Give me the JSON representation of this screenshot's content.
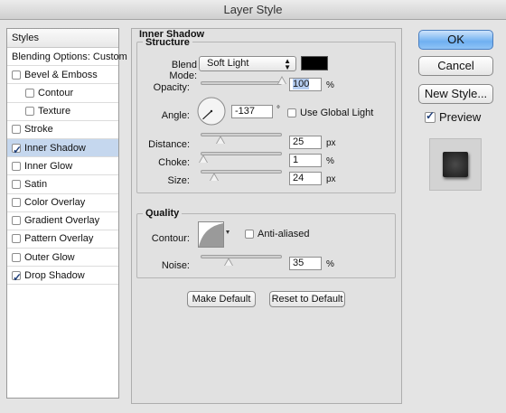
{
  "window": {
    "title": "Layer Style"
  },
  "styles_list": {
    "header": "Styles",
    "blending": "Blending Options: Custom",
    "items": [
      {
        "label": "Bevel & Emboss",
        "checked": false,
        "indent": false,
        "selected": false
      },
      {
        "label": "Contour",
        "checked": false,
        "indent": true,
        "selected": false
      },
      {
        "label": "Texture",
        "checked": false,
        "indent": true,
        "selected": false
      },
      {
        "label": "Stroke",
        "checked": false,
        "indent": false,
        "selected": false
      },
      {
        "label": "Inner Shadow",
        "checked": true,
        "indent": false,
        "selected": true
      },
      {
        "label": "Inner Glow",
        "checked": false,
        "indent": false,
        "selected": false
      },
      {
        "label": "Satin",
        "checked": false,
        "indent": false,
        "selected": false
      },
      {
        "label": "Color Overlay",
        "checked": false,
        "indent": false,
        "selected": false
      },
      {
        "label": "Gradient Overlay",
        "checked": false,
        "indent": false,
        "selected": false
      },
      {
        "label": "Pattern Overlay",
        "checked": false,
        "indent": false,
        "selected": false
      },
      {
        "label": "Outer Glow",
        "checked": false,
        "indent": false,
        "selected": false
      },
      {
        "label": "Drop Shadow",
        "checked": true,
        "indent": false,
        "selected": false
      }
    ]
  },
  "inner_shadow": {
    "title": "Inner Shadow",
    "structure": {
      "title": "Structure",
      "blend_mode_label": "Blend Mode:",
      "blend_mode_value": "Soft Light",
      "shadow_color": "#000000",
      "opacity_label": "Opacity:",
      "opacity_value": "100",
      "opacity_unit": "%",
      "angle_label": "Angle:",
      "angle_value": "-137",
      "angle_unit": "°",
      "use_global_light_label": "Use Global Light",
      "use_global_light_checked": false,
      "distance_label": "Distance:",
      "distance_value": "25",
      "distance_unit": "px",
      "choke_label": "Choke:",
      "choke_value": "1",
      "choke_unit": "%",
      "size_label": "Size:",
      "size_value": "24",
      "size_unit": "px"
    },
    "quality": {
      "title": "Quality",
      "contour_label": "Contour:",
      "anti_aliased_label": "Anti-aliased",
      "anti_aliased_checked": false,
      "noise_label": "Noise:",
      "noise_value": "35",
      "noise_unit": "%"
    },
    "make_default_label": "Make Default",
    "reset_default_label": "Reset to Default"
  },
  "side_buttons": {
    "ok": "OK",
    "cancel": "Cancel",
    "new_style": "New Style...",
    "preview_label": "Preview",
    "preview_checked": true
  },
  "colors": {
    "accent": "#6fb0f1",
    "selection": "#c5d7ee"
  }
}
